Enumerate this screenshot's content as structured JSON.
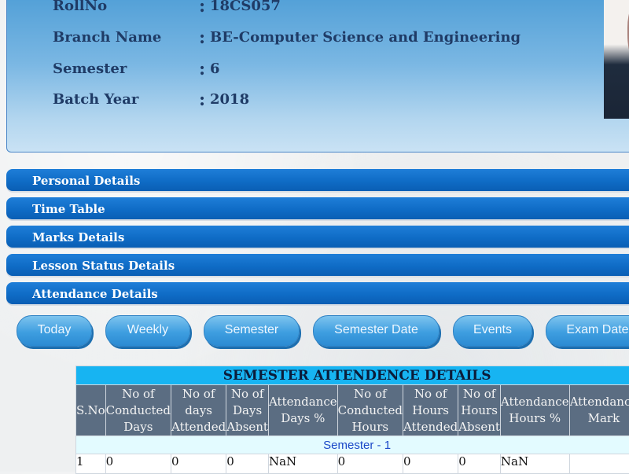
{
  "profile": {
    "fields": [
      {
        "label": "RollNo",
        "value": "18CS057"
      },
      {
        "label": "Branch Name",
        "value": "BE-Computer Science and Engineering"
      },
      {
        "label": "Semester",
        "value": "6"
      },
      {
        "label": "Batch Year",
        "value": "2018"
      }
    ],
    "colon": ":"
  },
  "sections": [
    {
      "label": "Personal Details"
    },
    {
      "label": "Time Table"
    },
    {
      "label": "Marks Details"
    },
    {
      "label": "Lesson Status Details"
    },
    {
      "label": "Attendance Details"
    }
  ],
  "tabs": [
    {
      "label": "Today"
    },
    {
      "label": "Weekly"
    },
    {
      "label": "Semester"
    },
    {
      "label": "Semester Date"
    },
    {
      "label": "Events"
    },
    {
      "label": "Exam Date"
    }
  ],
  "attendance_table": {
    "title": "SEMESTER ATTENDENCE DETAILS",
    "columns": [
      "S.No",
      "No of Conducted Days",
      "No of days Attended",
      "No of Days Absent",
      "Attendance Days %",
      "No of Conducted Hours",
      "No of Hours Attended",
      "No of Hours Absent",
      "Attendance Hours %",
      "Attendance Mark"
    ],
    "semester_label": "Semester - 1",
    "rows": [
      [
        "1",
        "0",
        "0",
        "0",
        "NaN",
        "0",
        "0",
        "0",
        "NaN",
        ""
      ]
    ]
  },
  "colors": {
    "section_bar": "#0f6cc6",
    "table_title_bg": "#17b4f2",
    "table_header_bg": "#5b6d82",
    "semester_row_bg": "#e3fbff"
  }
}
